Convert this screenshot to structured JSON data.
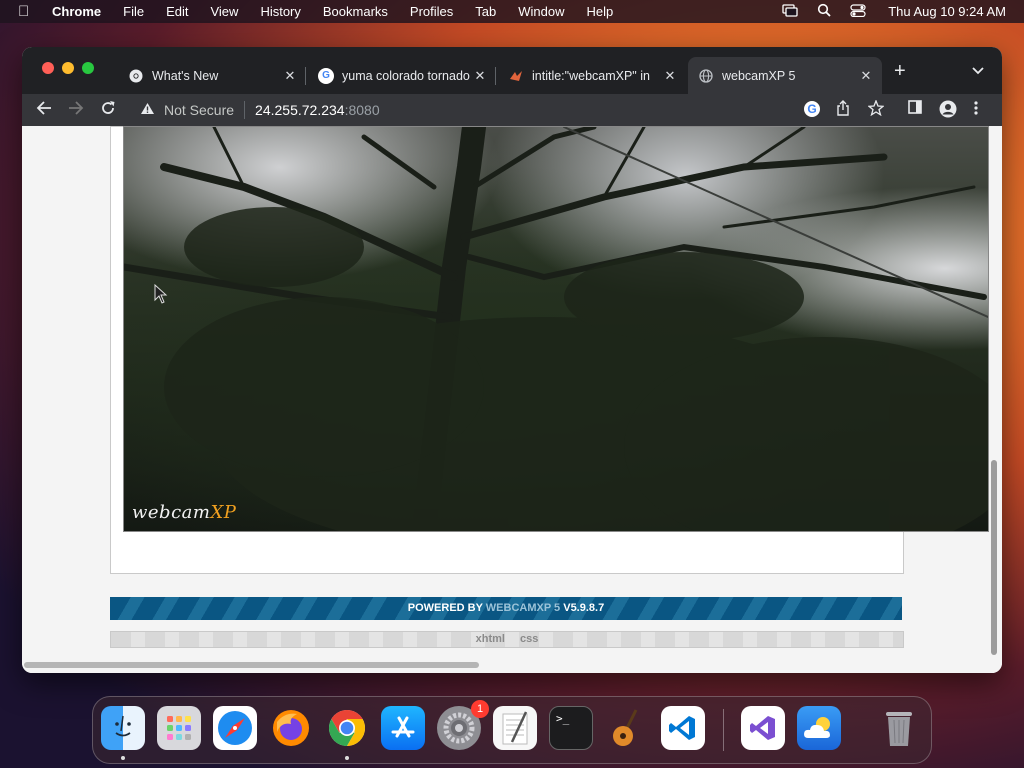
{
  "menubar": {
    "app_name": "Chrome",
    "items": [
      "File",
      "Edit",
      "View",
      "History",
      "Bookmarks",
      "Profiles",
      "Tab",
      "Window",
      "Help"
    ],
    "clock": "Thu Aug 10  9:24 AM"
  },
  "browser": {
    "tabs": [
      {
        "title": "What's New",
        "favicon": "chrome-icon",
        "active": false
      },
      {
        "title": "yuma colorado tornado",
        "favicon": "google-icon",
        "active": false
      },
      {
        "title": "intitle:\"webcamXP\" in",
        "favicon": "shodan-icon",
        "active": false
      },
      {
        "title": "webcamXP 5",
        "favicon": "globe-icon",
        "active": true
      }
    ],
    "security_label": "Not Secure",
    "url_host": "24.255.72.234",
    "url_port": ":8080"
  },
  "page": {
    "logo_text": "webcam",
    "logo_accent": "XP",
    "powered_prefix": "POWERED BY ",
    "powered_brand": "WEBCAMXP 5",
    "powered_version": " V5.9.8.7",
    "footer_links": [
      "xhtml",
      "css"
    ]
  },
  "dock": {
    "apps": [
      "Finder",
      "Launchpad",
      "Safari",
      "Firefox",
      "Google Chrome",
      "App Store",
      "System Settings",
      "TextEdit",
      "Terminal",
      "GarageBand",
      "Visual Studio Code",
      "Visual Studio",
      "Weather",
      "Trash"
    ],
    "system_settings_badge": "1"
  },
  "colors": {
    "powered_bar": "#0a5683",
    "tab_bar": "#202124",
    "toolbar": "#35363a"
  }
}
